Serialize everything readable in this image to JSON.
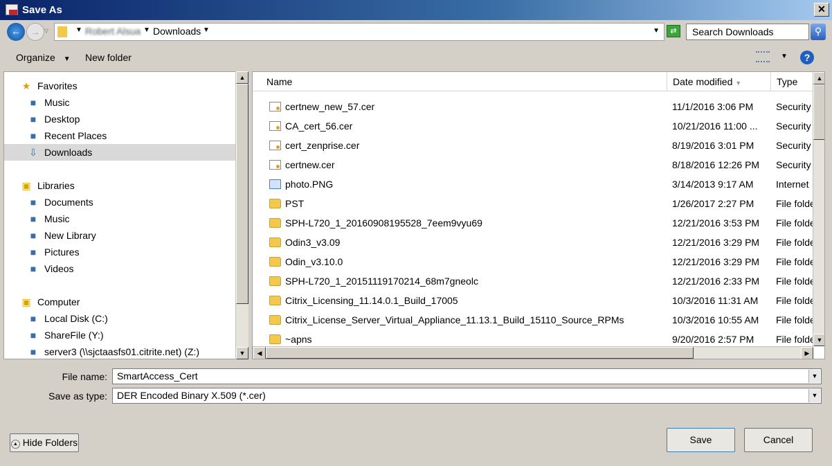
{
  "window": {
    "title": "Save As"
  },
  "address": {
    "crumbs": [
      "Robert Alsua",
      "Downloads"
    ]
  },
  "search": {
    "placeholder": "Search Downloads"
  },
  "toolbar": {
    "organize": "Organize",
    "new_folder": "New folder"
  },
  "nav": {
    "groups": [
      {
        "label": "Favorites",
        "icon": "star-icon",
        "items": [
          {
            "label": "Music",
            "icon": "music-icon"
          },
          {
            "label": "Desktop",
            "icon": "desktop-icon"
          },
          {
            "label": "Recent Places",
            "icon": "recent-places-icon"
          },
          {
            "label": "Downloads",
            "icon": "downloads-icon",
            "selected": true
          }
        ]
      },
      {
        "label": "Libraries",
        "icon": "libraries-icon",
        "items": [
          {
            "label": "Documents",
            "icon": "documents-icon"
          },
          {
            "label": "Music",
            "icon": "music-icon"
          },
          {
            "label": "New Library",
            "icon": "library-icon"
          },
          {
            "label": "Pictures",
            "icon": "pictures-icon"
          },
          {
            "label": "Videos",
            "icon": "videos-icon"
          }
        ]
      },
      {
        "label": "Computer",
        "icon": "computer-icon",
        "items": [
          {
            "label": "Local Disk (C:)",
            "icon": "disk-icon"
          },
          {
            "label": "ShareFile (Y:)",
            "icon": "sharefile-icon"
          },
          {
            "label": "server3 (\\\\sjctaasfs01.citrite.net) (Z:)",
            "icon": "network-drive-icon"
          }
        ]
      }
    ]
  },
  "columns": {
    "name": "Name",
    "date": "Date modified",
    "type": "Type"
  },
  "files": [
    {
      "name": "certnew_new_57.cer",
      "date": "11/1/2016 3:06 PM",
      "type": "Security",
      "kind": "cert"
    },
    {
      "name": "CA_cert_56.cer",
      "date": "10/21/2016 11:00 ...",
      "type": "Security",
      "kind": "cert"
    },
    {
      "name": "cert_zenprise.cer",
      "date": "8/19/2016 3:01 PM",
      "type": "Security",
      "kind": "cert"
    },
    {
      "name": "certnew.cer",
      "date": "8/18/2016 12:26 PM",
      "type": "Security",
      "kind": "cert"
    },
    {
      "name": "photo.PNG",
      "date": "3/14/2013 9:17 AM",
      "type": "Internet",
      "kind": "img"
    },
    {
      "name": "PST",
      "date": "1/26/2017 2:27 PM",
      "type": "File folder",
      "kind": "folder"
    },
    {
      "name": "SPH-L720_1_20160908195528_7eem9vyu69",
      "date": "12/21/2016 3:53 PM",
      "type": "File folder",
      "kind": "folder"
    },
    {
      "name": "Odin3_v3.09",
      "date": "12/21/2016 3:29 PM",
      "type": "File folder",
      "kind": "folder"
    },
    {
      "name": "Odin_v3.10.0",
      "date": "12/21/2016 3:29 PM",
      "type": "File folder",
      "kind": "folder"
    },
    {
      "name": "SPH-L720_1_20151119170214_68m7gneolc",
      "date": "12/21/2016 2:33 PM",
      "type": "File folder",
      "kind": "folder"
    },
    {
      "name": "Citrix_Licensing_11.14.0.1_Build_17005",
      "date": "10/3/2016 11:31 AM",
      "type": "File folder",
      "kind": "folder"
    },
    {
      "name": "Citrix_License_Server_Virtual_Appliance_11.13.1_Build_15110_Source_RPMs",
      "date": "10/3/2016 10:55 AM",
      "type": "File folder",
      "kind": "folder"
    },
    {
      "name": "~apns",
      "date": "9/20/2016 2:57 PM",
      "type": "File folder",
      "kind": "folder"
    }
  ],
  "form": {
    "file_name_label": "File name:",
    "file_name": "SmartAccess_Cert",
    "type_label": "Save as type:",
    "type_value": "DER Encoded Binary X.509 (*.cer)"
  },
  "buttons": {
    "hide_folders": "Hide Folders",
    "save": "Save",
    "cancel": "Cancel"
  }
}
